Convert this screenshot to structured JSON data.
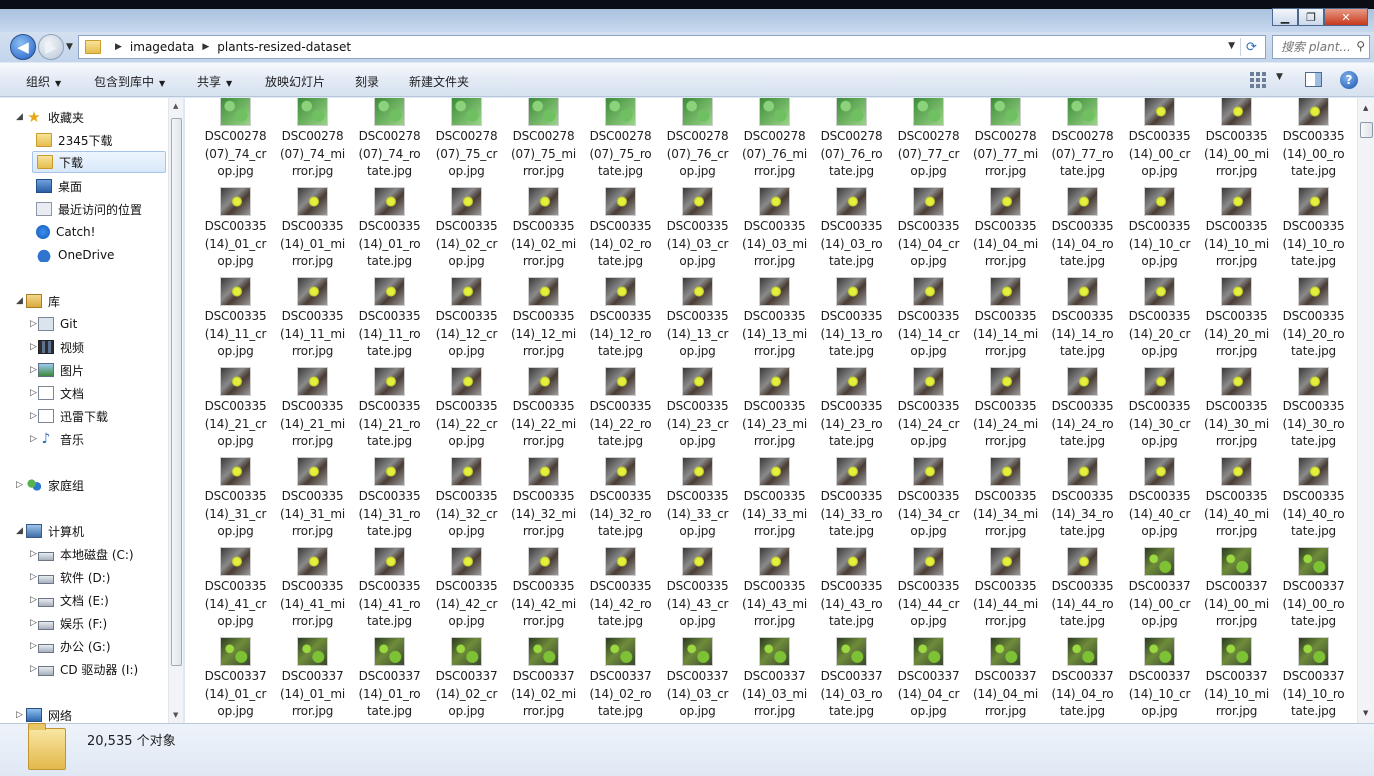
{
  "window": {
    "min_label": "▁",
    "max_label": "❐",
    "close_label": "✕"
  },
  "address": {
    "crumbs": [
      "imagedata",
      "plants-resized-dataset"
    ],
    "search_placeholder": "搜索 plant...",
    "refresh_icon": "refresh-icon"
  },
  "toolbar": {
    "organize": "组织",
    "include_library": "包含到库中",
    "share": "共享",
    "slideshow": "放映幻灯片",
    "burn": "刻录",
    "new_folder": "新建文件夹"
  },
  "sidebar": {
    "favorites": "收藏夹",
    "fav_items": [
      "2345下载",
      "下载",
      "桌面",
      "最近访问的位置",
      "Catch!",
      "OneDrive"
    ],
    "libraries": "库",
    "lib_items": [
      "Git",
      "视频",
      "图片",
      "文档",
      "迅雷下载",
      "音乐"
    ],
    "homegroup": "家庭组",
    "computer": "计算机",
    "drives": [
      "本地磁盘 (C:)",
      "软件 (D:)",
      "文档 (E:)",
      "娱乐 (F:)",
      "办公 (G:)",
      "CD 驱动器 (I:)"
    ],
    "network": "网络"
  },
  "files": [
    {
      "n": "DSC00278\n(07)_74_cr\nop.jpg",
      "t": "leaf"
    },
    {
      "n": "DSC00278\n(07)_74_mi\nrror.jpg",
      "t": "leaf"
    },
    {
      "n": "DSC00278\n(07)_74_ro\ntate.jpg",
      "t": "leaf"
    },
    {
      "n": "DSC00278\n(07)_75_cr\nop.jpg",
      "t": "leaf"
    },
    {
      "n": "DSC00278\n(07)_75_mi\nrror.jpg",
      "t": "leaf"
    },
    {
      "n": "DSC00278\n(07)_75_ro\ntate.jpg",
      "t": "leaf"
    },
    {
      "n": "DSC00278\n(07)_76_cr\nop.jpg",
      "t": "leaf"
    },
    {
      "n": "DSC00278\n(07)_76_mi\nrror.jpg",
      "t": "leaf"
    },
    {
      "n": "DSC00278\n(07)_76_ro\ntate.jpg",
      "t": "leaf"
    },
    {
      "n": "DSC00278\n(07)_77_cr\nop.jpg",
      "t": "leaf"
    },
    {
      "n": "DSC00278\n(07)_77_mi\nrror.jpg",
      "t": "leaf"
    },
    {
      "n": "DSC00278\n(07)_77_ro\ntate.jpg",
      "t": "leaf"
    },
    {
      "n": "DSC00335\n(14)_00_cr\nop.jpg",
      "t": "flower"
    },
    {
      "n": "DSC00335\n(14)_00_mi\nrror.jpg",
      "t": "flower"
    },
    {
      "n": "DSC00335\n(14)_00_ro\ntate.jpg",
      "t": "flower"
    },
    {
      "n": "DSC00335\n(14)_01_cr\nop.jpg",
      "t": "flower"
    },
    {
      "n": "DSC00335\n(14)_01_mi\nrror.jpg",
      "t": "flower"
    },
    {
      "n": "DSC00335\n(14)_01_ro\ntate.jpg",
      "t": "flower"
    },
    {
      "n": "DSC00335\n(14)_02_cr\nop.jpg",
      "t": "flower"
    },
    {
      "n": "DSC00335\n(14)_02_mi\nrror.jpg",
      "t": "flower"
    },
    {
      "n": "DSC00335\n(14)_02_ro\ntate.jpg",
      "t": "flower"
    },
    {
      "n": "DSC00335\n(14)_03_cr\nop.jpg",
      "t": "flower"
    },
    {
      "n": "DSC00335\n(14)_03_mi\nrror.jpg",
      "t": "flower"
    },
    {
      "n": "DSC00335\n(14)_03_ro\ntate.jpg",
      "t": "flower"
    },
    {
      "n": "DSC00335\n(14)_04_cr\nop.jpg",
      "t": "flower"
    },
    {
      "n": "DSC00335\n(14)_04_mi\nrror.jpg",
      "t": "flower"
    },
    {
      "n": "DSC00335\n(14)_04_ro\ntate.jpg",
      "t": "flower"
    },
    {
      "n": "DSC00335\n(14)_10_cr\nop.jpg",
      "t": "flower"
    },
    {
      "n": "DSC00335\n(14)_10_mi\nrror.jpg",
      "t": "flower"
    },
    {
      "n": "DSC00335\n(14)_10_ro\ntate.jpg",
      "t": "flower"
    },
    {
      "n": "DSC00335\n(14)_11_cr\nop.jpg",
      "t": "flower"
    },
    {
      "n": "DSC00335\n(14)_11_mi\nrror.jpg",
      "t": "flower"
    },
    {
      "n": "DSC00335\n(14)_11_ro\ntate.jpg",
      "t": "flower"
    },
    {
      "n": "DSC00335\n(14)_12_cr\nop.jpg",
      "t": "flower"
    },
    {
      "n": "DSC00335\n(14)_12_mi\nrror.jpg",
      "t": "flower"
    },
    {
      "n": "DSC00335\n(14)_12_ro\ntate.jpg",
      "t": "flower"
    },
    {
      "n": "DSC00335\n(14)_13_cr\nop.jpg",
      "t": "flower"
    },
    {
      "n": "DSC00335\n(14)_13_mi\nrror.jpg",
      "t": "flower"
    },
    {
      "n": "DSC00335\n(14)_13_ro\ntate.jpg",
      "t": "flower"
    },
    {
      "n": "DSC00335\n(14)_14_cr\nop.jpg",
      "t": "flower"
    },
    {
      "n": "DSC00335\n(14)_14_mi\nrror.jpg",
      "t": "flower"
    },
    {
      "n": "DSC00335\n(14)_14_ro\ntate.jpg",
      "t": "flower"
    },
    {
      "n": "DSC00335\n(14)_20_cr\nop.jpg",
      "t": "flower"
    },
    {
      "n": "DSC00335\n(14)_20_mi\nrror.jpg",
      "t": "flower"
    },
    {
      "n": "DSC00335\n(14)_20_ro\ntate.jpg",
      "t": "flower"
    },
    {
      "n": "DSC00335\n(14)_21_cr\nop.jpg",
      "t": "flower"
    },
    {
      "n": "DSC00335\n(14)_21_mi\nrror.jpg",
      "t": "flower"
    },
    {
      "n": "DSC00335\n(14)_21_ro\ntate.jpg",
      "t": "flower"
    },
    {
      "n": "DSC00335\n(14)_22_cr\nop.jpg",
      "t": "flower"
    },
    {
      "n": "DSC00335\n(14)_22_mi\nrror.jpg",
      "t": "flower"
    },
    {
      "n": "DSC00335\n(14)_22_ro\ntate.jpg",
      "t": "flower"
    },
    {
      "n": "DSC00335\n(14)_23_cr\nop.jpg",
      "t": "flower"
    },
    {
      "n": "DSC00335\n(14)_23_mi\nrror.jpg",
      "t": "flower"
    },
    {
      "n": "DSC00335\n(14)_23_ro\ntate.jpg",
      "t": "flower"
    },
    {
      "n": "DSC00335\n(14)_24_cr\nop.jpg",
      "t": "flower"
    },
    {
      "n": "DSC00335\n(14)_24_mi\nrror.jpg",
      "t": "flower"
    },
    {
      "n": "DSC00335\n(14)_24_ro\ntate.jpg",
      "t": "flower"
    },
    {
      "n": "DSC00335\n(14)_30_cr\nop.jpg",
      "t": "flower"
    },
    {
      "n": "DSC00335\n(14)_30_mi\nrror.jpg",
      "t": "flower"
    },
    {
      "n": "DSC00335\n(14)_30_ro\ntate.jpg",
      "t": "flower"
    },
    {
      "n": "DSC00335\n(14)_31_cr\nop.jpg",
      "t": "flower"
    },
    {
      "n": "DSC00335\n(14)_31_mi\nrror.jpg",
      "t": "flower"
    },
    {
      "n": "DSC00335\n(14)_31_ro\ntate.jpg",
      "t": "flower"
    },
    {
      "n": "DSC00335\n(14)_32_cr\nop.jpg",
      "t": "flower"
    },
    {
      "n": "DSC00335\n(14)_32_mi\nrror.jpg",
      "t": "flower"
    },
    {
      "n": "DSC00335\n(14)_32_ro\ntate.jpg",
      "t": "flower"
    },
    {
      "n": "DSC00335\n(14)_33_cr\nop.jpg",
      "t": "flower"
    },
    {
      "n": "DSC00335\n(14)_33_mi\nrror.jpg",
      "t": "flower"
    },
    {
      "n": "DSC00335\n(14)_33_ro\ntate.jpg",
      "t": "flower"
    },
    {
      "n": "DSC00335\n(14)_34_cr\nop.jpg",
      "t": "flower"
    },
    {
      "n": "DSC00335\n(14)_34_mi\nrror.jpg",
      "t": "flower"
    },
    {
      "n": "DSC00335\n(14)_34_ro\ntate.jpg",
      "t": "flower"
    },
    {
      "n": "DSC00335\n(14)_40_cr\nop.jpg",
      "t": "flower"
    },
    {
      "n": "DSC00335\n(14)_40_mi\nrror.jpg",
      "t": "flower"
    },
    {
      "n": "DSC00335\n(14)_40_ro\ntate.jpg",
      "t": "flower"
    },
    {
      "n": "DSC00335\n(14)_41_cr\nop.jpg",
      "t": "flower"
    },
    {
      "n": "DSC00335\n(14)_41_mi\nrror.jpg",
      "t": "flower"
    },
    {
      "n": "DSC00335\n(14)_41_ro\ntate.jpg",
      "t": "flower"
    },
    {
      "n": "DSC00335\n(14)_42_cr\nop.jpg",
      "t": "flower"
    },
    {
      "n": "DSC00335\n(14)_42_mi\nrror.jpg",
      "t": "flower"
    },
    {
      "n": "DSC00335\n(14)_42_ro\ntate.jpg",
      "t": "flower"
    },
    {
      "n": "DSC00335\n(14)_43_cr\nop.jpg",
      "t": "flower"
    },
    {
      "n": "DSC00335\n(14)_43_mi\nrror.jpg",
      "t": "flower"
    },
    {
      "n": "DSC00335\n(14)_43_ro\ntate.jpg",
      "t": "flower"
    },
    {
      "n": "DSC00335\n(14)_44_cr\nop.jpg",
      "t": "flower"
    },
    {
      "n": "DSC00335\n(14)_44_mi\nrror.jpg",
      "t": "flower"
    },
    {
      "n": "DSC00335\n(14)_44_ro\ntate.jpg",
      "t": "flower"
    },
    {
      "n": "DSC00337\n(14)_00_cr\nop.jpg",
      "t": "moss"
    },
    {
      "n": "DSC00337\n(14)_00_mi\nrror.jpg",
      "t": "moss"
    },
    {
      "n": "DSC00337\n(14)_00_ro\ntate.jpg",
      "t": "moss"
    },
    {
      "n": "DSC00337\n(14)_01_cr\nop.jpg",
      "t": "moss"
    },
    {
      "n": "DSC00337\n(14)_01_mi\nrror.jpg",
      "t": "moss"
    },
    {
      "n": "DSC00337\n(14)_01_ro\ntate.jpg",
      "t": "moss"
    },
    {
      "n": "DSC00337\n(14)_02_cr\nop.jpg",
      "t": "moss"
    },
    {
      "n": "DSC00337\n(14)_02_mi\nrror.jpg",
      "t": "moss"
    },
    {
      "n": "DSC00337\n(14)_02_ro\ntate.jpg",
      "t": "moss"
    },
    {
      "n": "DSC00337\n(14)_03_cr\nop.jpg",
      "t": "moss"
    },
    {
      "n": "DSC00337\n(14)_03_mi\nrror.jpg",
      "t": "moss"
    },
    {
      "n": "DSC00337\n(14)_03_ro\ntate.jpg",
      "t": "moss"
    },
    {
      "n": "DSC00337\n(14)_04_cr\nop.jpg",
      "t": "moss"
    },
    {
      "n": "DSC00337\n(14)_04_mi\nrror.jpg",
      "t": "moss"
    },
    {
      "n": "DSC00337\n(14)_04_ro\ntate.jpg",
      "t": "moss"
    },
    {
      "n": "DSC00337\n(14)_10_cr\nop.jpg",
      "t": "moss"
    },
    {
      "n": "DSC00337\n(14)_10_mi\nrror.jpg",
      "t": "moss"
    },
    {
      "n": "DSC00337\n(14)_10_ro\ntate.jpg",
      "t": "moss"
    }
  ],
  "status": {
    "count": "20,535 个对象"
  }
}
